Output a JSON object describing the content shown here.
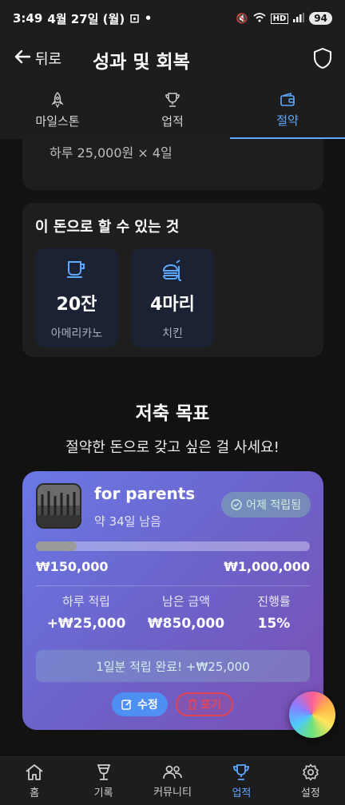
{
  "status_bar": {
    "time": "3:49",
    "date": "4월 27일 (월)",
    "battery": "94"
  },
  "header": {
    "back_label": "뒤로",
    "title": "성과 및 회복"
  },
  "tabs": [
    {
      "label": "마일스톤",
      "icon": "rocket-icon"
    },
    {
      "label": "업적",
      "icon": "trophy-icon"
    },
    {
      "label": "절약",
      "icon": "wallet-icon"
    }
  ],
  "peek_card": {
    "text": "하루 25,000원 × 4일"
  },
  "can_buy": {
    "title": "이 돈으로 할 수 있는 것",
    "items": [
      {
        "value": "20잔",
        "label": "아메리카노",
        "icon": "coffee-cup-icon"
      },
      {
        "value": "4마리",
        "label": "치킨",
        "icon": "fast-food-icon"
      }
    ]
  },
  "savings_goal": {
    "title": "저축 목표",
    "subtitle": "절약한 돈으로 갖고 싶은 걸 사세요!",
    "card": {
      "name": "for parents",
      "remaining": "약 34일 남음",
      "badge": "어제 적립됨",
      "progress": 0.15,
      "current": "₩150,000",
      "target": "₩1,000,000",
      "stats": [
        {
          "label": "하루 적립",
          "value": "+₩25,000"
        },
        {
          "label": "남은 금액",
          "value": "₩850,000"
        },
        {
          "label": "진행률",
          "value": "15%"
        }
      ],
      "done_message": "1일분 적립 완료! +₩25,000",
      "edit_label": "수정",
      "giveup_label": "포기"
    }
  },
  "bottom_nav": [
    {
      "label": "홈",
      "icon": "home-icon"
    },
    {
      "label": "기록",
      "icon": "glass-icon"
    },
    {
      "label": "커뮤니티",
      "icon": "people-icon"
    },
    {
      "label": "업적",
      "icon": "trophy-icon"
    },
    {
      "label": "설정",
      "icon": "gear-icon"
    }
  ],
  "colors": {
    "accent": "#5fa8ff",
    "background": "#121212",
    "danger": "#e8455a"
  }
}
